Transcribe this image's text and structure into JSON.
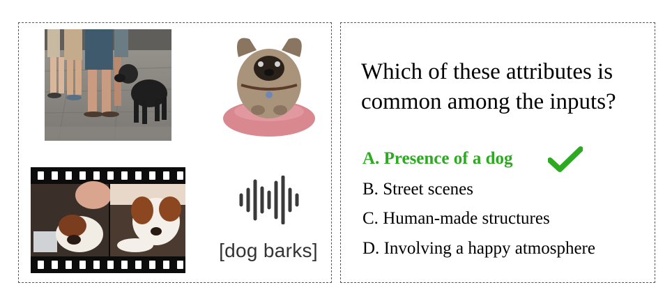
{
  "question": "Which of these attributes is common among the inputs?",
  "answers": [
    {
      "letter": "A.",
      "text": "Presence of a dog",
      "correct": true
    },
    {
      "letter": "B.",
      "text": "Street scenes",
      "correct": false
    },
    {
      "letter": "C.",
      "text": "Human-made structures",
      "correct": false
    },
    {
      "letter": "D.",
      "text": "Involving a happy atmosphere",
      "correct": false
    }
  ],
  "audio_caption": "[dog barks]",
  "icons": {
    "correct": "check-icon",
    "audio": "sound-wave-icon",
    "video": "film-strip-icon"
  },
  "colors": {
    "correct_answer": "#2eaa22",
    "panel_border": "#555555"
  }
}
